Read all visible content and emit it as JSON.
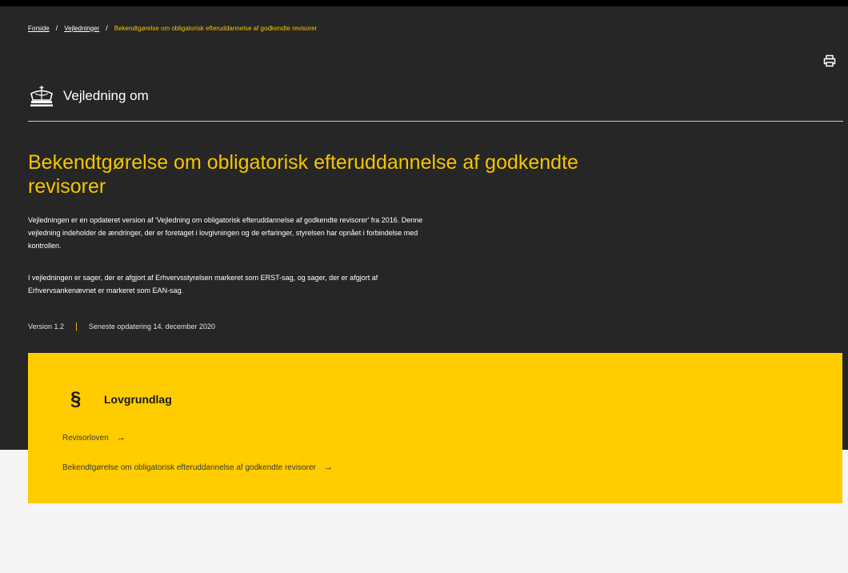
{
  "breadcrumb": {
    "items": [
      "Forside",
      "Vejledninger"
    ],
    "current": "Bekendtgørelse om obligatorisk efteruddannelse af godkendte revisorer"
  },
  "header": {
    "brand_text": "Vejledning om",
    "print_icon": "print-icon"
  },
  "main": {
    "title": "Bekendtgørelse om obligatorisk efteruddannelse af godkendte revisorer",
    "paragraphs": [
      "Vejledningen er en opdateret version af 'Vejledning om obligatorisk efteruddannelse af godkendte revisorer' fra 2016. Denne vejledning indeholder de ændringer, der er foretaget i lovgivningen og de erfaringer, styrelsen har opnået i forbindelse med kontrollen.",
      "I vejledningen er sager, der er afgjort af Erhvervsstyrelsen markeret som ERST-sag, og sager, der er afgjort af Erhvervsankenævnet er markeret som EAN-sag."
    ],
    "version": "Version 1.2",
    "updated": "Seneste opdatering 14. december 2020"
  },
  "lovgrundlag": {
    "icon": "§",
    "title": "Lovgrundlag",
    "links": [
      "Revisorloven",
      "Bekendtgørelse om obligatorisk efteruddannelse af godkendte revisorer"
    ],
    "arrow": "→"
  },
  "colors": {
    "dark_bg": "#262626",
    "accent_yellow": "#f5c400",
    "card_yellow": "#ffcc00",
    "page_bg": "#f5f5f5"
  }
}
